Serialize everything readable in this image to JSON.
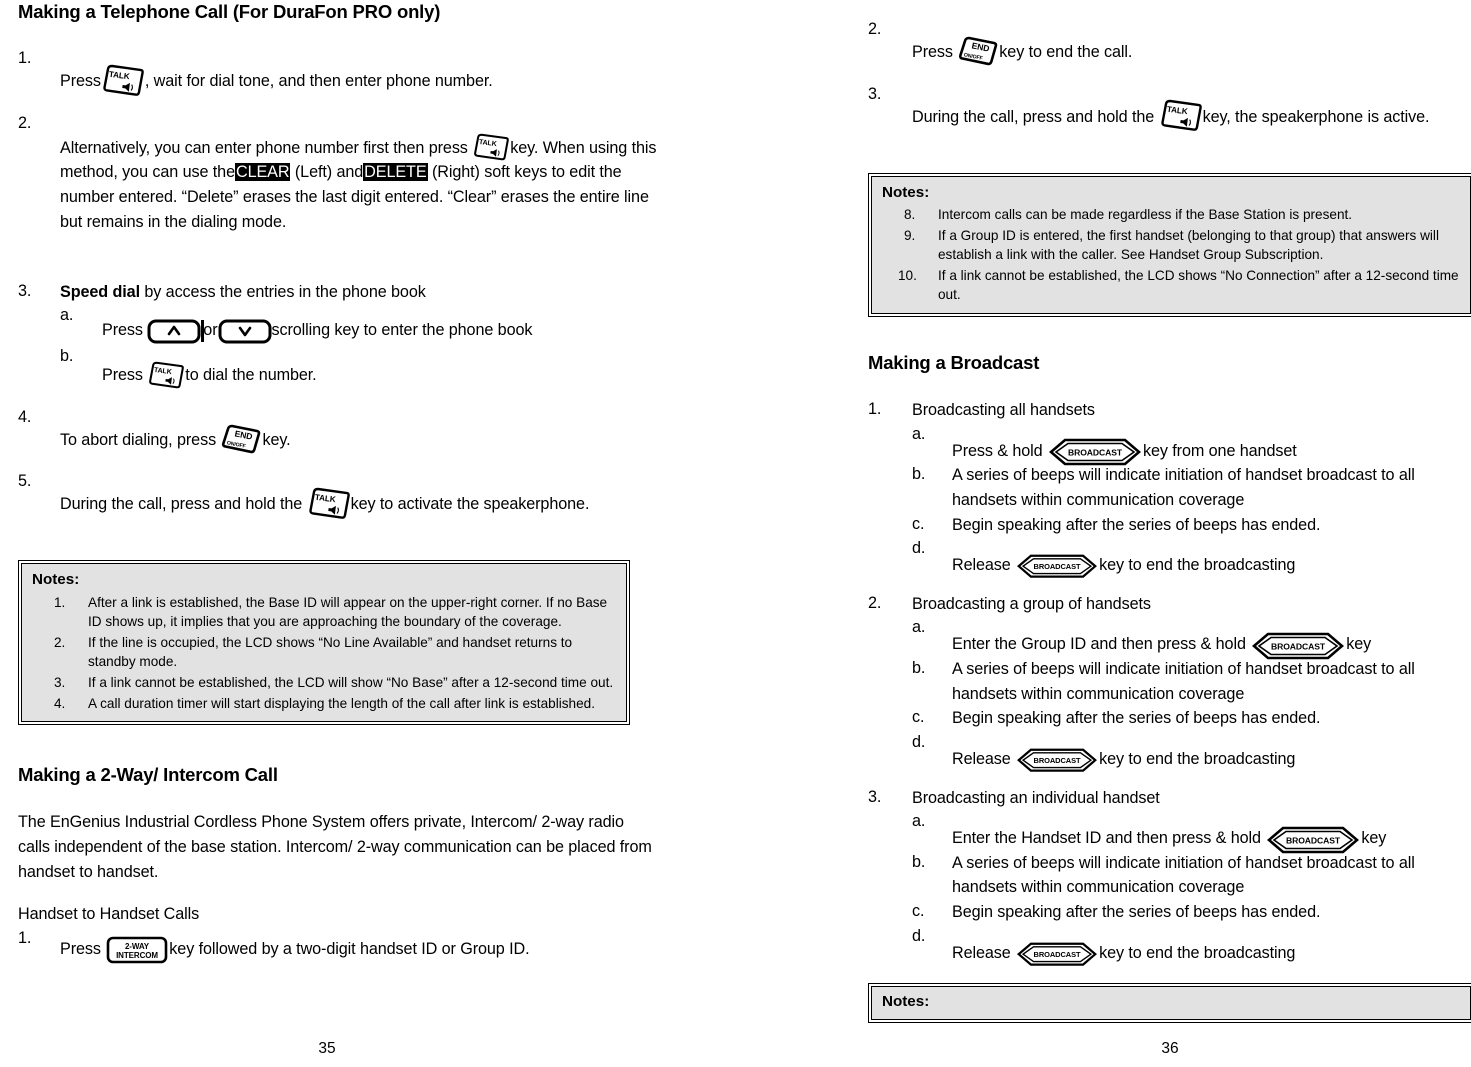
{
  "document": {
    "left_page_number": "35",
    "right_page_number": "36"
  },
  "left_column": {
    "heading": "Making a Telephone Call (For DuraFon PRO only)",
    "steps": [
      {
        "marker": "1.",
        "pre": "Press",
        "icon": "talk-key-icon",
        "post": ", wait for dial tone, and then enter phone number."
      },
      {
        "marker": "2.",
        "pre": "Alternatively, you can enter phone number first then press",
        "icon": "talk-key-icon",
        "post_a": "key.",
        "post_b": "When using this method, you can use the",
        "highlight_1": "CLEAR",
        "mid": "(Left) and",
        "highlight_2": "DELETE",
        "post_c": "(Right) soft keys to edit the number entered.  “Delete” erases the last digit entered.  “Clear” erases the entire line but remains in the dialing mode."
      },
      {
        "marker": "3.",
        "bold_lead": "Speed dial",
        "text": " by access the entries in the phone book",
        "sub": [
          {
            "marker": "a.",
            "pre": "Press",
            "icon_up": "scroll-up-key-icon",
            "mid": "or",
            "icon_down": "scroll-down-key-icon",
            "post": "scrolling key to enter the phone book"
          },
          {
            "marker": "b.",
            "pre": "Press",
            "icon": "talk-key-icon",
            "post": "to dial the number."
          }
        ]
      },
      {
        "marker": "4.",
        "pre": "To abort dialing, press",
        "icon": "end-key-icon",
        "post": "key."
      },
      {
        "marker": "5.",
        "pre": "During the call, press and hold the",
        "icon": "talk-key-icon",
        "post": "key to activate the speakerphone."
      }
    ],
    "notes": {
      "title": "Notes:",
      "items": [
        {
          "num": "1.",
          "text": "After a link is established, the Base ID will appear on the upper-right corner.  If no Base ID shows up, it implies that you are approaching the boundary of the coverage."
        },
        {
          "num": "2.",
          "text": "If the line is occupied, the LCD shows “No Line Available” and handset returns to standby mode."
        },
        {
          "num": "3.",
          "text": "If a link cannot be established, the LCD will show “No Base” after a 12-second time out."
        },
        {
          "num": "4.",
          "text": "A call duration timer will start displaying the length of the call after link is established."
        }
      ]
    },
    "section2": {
      "heading": "Making a 2-Way/ Intercom Call",
      "paragraph": "The EnGenius Industrial Cordless Phone System offers private, Intercom/ 2-way radio calls independent of the base station.  Intercom/ 2-way communication can be placed from handset to handset.",
      "subheading": "Handset to Handset Calls",
      "step": {
        "marker": "1.",
        "pre": "Press",
        "icon": "two-way-intercom-key-icon",
        "post": "key followed by a two-digit handset ID or Group ID."
      }
    }
  },
  "right_column": {
    "steps": [
      {
        "marker": "2.",
        "pre": "Press",
        "icon": "end-key-icon",
        "post": "key to end the call."
      },
      {
        "marker": "3.",
        "pre": "During the call, press and hold the",
        "icon": "talk-key-icon",
        "post": "key, the speakerphone is active."
      }
    ],
    "notes": {
      "title": "Notes:",
      "items": [
        {
          "num": "8.",
          "text": "Intercom calls can be made regardless if the Base Station is present."
        },
        {
          "num": "9.",
          "text": "If a Group ID is entered, the first handset (belonging to that group) that answers will establish a link with the caller.  See Handset Group Subscription."
        },
        {
          "num": "10.",
          "text": "If a link cannot be established, the LCD shows “No Connection” after a 12-second time out."
        }
      ]
    },
    "broadcast": {
      "heading": "Making a Broadcast",
      "groups": [
        {
          "marker": "1.",
          "title": "Broadcasting all handsets",
          "items": [
            {
              "marker": "a.",
              "pre": "Press & hold",
              "icon": "broadcast-key-icon",
              "post": "key from one handset"
            },
            {
              "marker": "b.",
              "text": " A series of beeps will indicate initiation of handset broadcast to all handsets within communication coverage"
            },
            {
              "marker": "c.",
              "text": " Begin speaking after the series of beeps has ended."
            },
            {
              "marker": "d.",
              "pre": "Release",
              "icon": "broadcast-key-icon",
              "post": "key to end the broadcasting"
            }
          ]
        },
        {
          "marker": "2.",
          "title": "Broadcasting a group of handsets",
          "items": [
            {
              "marker": "a.",
              "pre": "Enter the Group ID and then press & hold",
              "icon": "broadcast-key-icon",
              "post": "key"
            },
            {
              "marker": "b.",
              "text": "A series of beeps will indicate initiation of handset broadcast to all handsets within communication coverage"
            },
            {
              "marker": "c.",
              "text": "Begin speaking after the series of beeps has ended."
            },
            {
              "marker": "d.",
              "pre": "Release",
              "icon": "broadcast-key-icon",
              "post": "key to end the broadcasting"
            }
          ]
        },
        {
          "marker": "3.",
          "title": "Broadcasting an individual handset",
          "items": [
            {
              "marker": "a.",
              "pre": "Enter the Handset ID and then press & hold",
              "icon": "broadcast-key-icon",
              "post": "key"
            },
            {
              "marker": "b.",
              "text": "A series of beeps will indicate initiation of handset broadcast to all handsets within communication coverage"
            },
            {
              "marker": "c.",
              "text": "Begin speaking after the series of beeps has ended."
            },
            {
              "marker": "d.",
              "pre": "Release",
              "icon": "broadcast-key-icon",
              "post": "key to end the broadcasting"
            }
          ]
        }
      ]
    },
    "bottom_notes": {
      "title": "Notes:"
    }
  },
  "key_labels": {
    "talk": "TALK",
    "end_main": "END",
    "end_sub": "ON/OFF",
    "two_way_line1": "2-WAY",
    "two_way_line2": "INTERCOM",
    "broadcast": "BROADCAST"
  },
  "colors": {
    "page_background": "#ffffff",
    "text": "#000000",
    "notes_fill": "#e2e2e2",
    "highlight_fill": "#000000",
    "highlight_text": "#ffffff"
  }
}
